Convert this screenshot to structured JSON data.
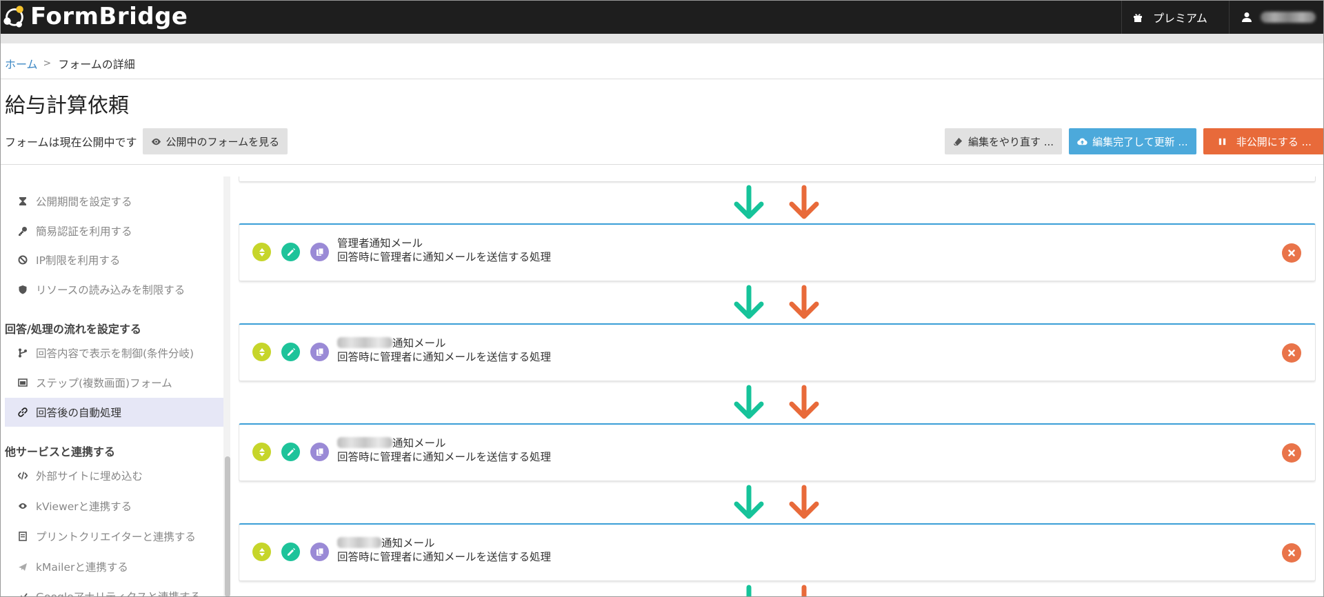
{
  "app": {
    "brand": "FormBridge",
    "premium_label": "プレミアム"
  },
  "breadcrumb": {
    "home": "ホーム",
    "separator": ">",
    "current": "フォームの詳細"
  },
  "page": {
    "title": "給与計算依頼",
    "status_text": "フォームは現在公開中です",
    "view_button": "公開中のフォームを見る"
  },
  "actions": {
    "redo": "編集をやり直す ...",
    "finish": "編集完了して更新 ...",
    "unpublish": "非公開にする ..."
  },
  "sidebar": {
    "items_top": [
      {
        "label": "公開期間を設定する",
        "icon": "hourglass-icon"
      },
      {
        "label": "簡易認証を利用する",
        "icon": "key-icon"
      },
      {
        "label": "IP制限を利用する",
        "icon": "ban-icon"
      },
      {
        "label": "リソースの読み込みを制限する",
        "icon": "shield-icon"
      }
    ],
    "section_flow": "回答/処理の流れを設定する",
    "items_flow": [
      {
        "label": "回答内容で表示を制御(条件分岐)",
        "icon": "branch-icon"
      },
      {
        "label": "ステップ(複数画面)フォーム",
        "icon": "window-icon"
      },
      {
        "label": "回答後の自動処理",
        "icon": "link-icon",
        "active": true
      }
    ],
    "section_services": "他サービスと連携する",
    "items_services": [
      {
        "label": "外部サイトに埋め込む",
        "icon": "code-icon"
      },
      {
        "label": "kViewerと連携する",
        "icon": "eye-icon"
      },
      {
        "label": "プリントクリエイターと連携する",
        "icon": "document-icon"
      },
      {
        "label": "kMailerと連携する",
        "icon": "mail-icon"
      },
      {
        "label": "Googleアナリティクスと連携する",
        "icon": "chart-icon"
      }
    ]
  },
  "flow": {
    "cards": [
      {
        "title": "管理者通知メール",
        "title_suffix": "",
        "desc": "回答時に管理者に通知メールを送信する処理"
      },
      {
        "title": "",
        "title_suffix": "通知メール",
        "desc": "回答時に管理者に通知メールを送信する処理"
      },
      {
        "title": "",
        "title_suffix": "通知メール",
        "desc": "回答時に管理者に通知メールを送信する処理"
      },
      {
        "title": "",
        "title_suffix": "通知メール",
        "desc": "回答時に管理者に通知メールを送信する処理"
      }
    ]
  },
  "colors": {
    "accent_blue": "#4ca9db",
    "accent_orange": "#e86a3a",
    "arrow_green": "#16c39a",
    "arrow_orange": "#e86a3a"
  }
}
